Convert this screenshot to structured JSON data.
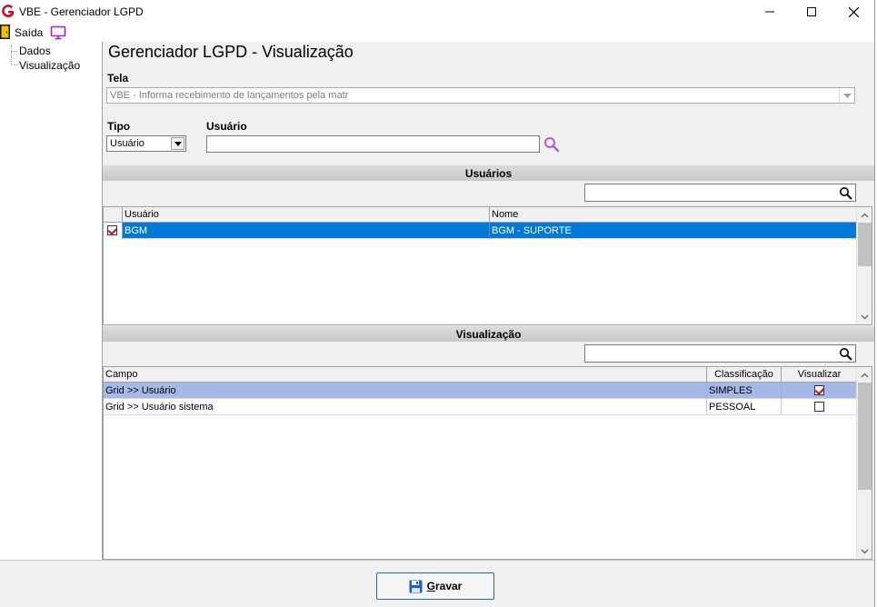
{
  "window": {
    "title": "VBE - Gerenciador LGPD",
    "minimize_icon": "minimize-icon",
    "maximize_icon": "maximize-icon",
    "close_icon": "close-icon"
  },
  "menu": {
    "exit_label": "Saída",
    "exit_icon": "exit-door-icon",
    "monitor_icon": "monitor-icon"
  },
  "tree": {
    "items": [
      "Dados",
      "Visualização"
    ]
  },
  "page": {
    "title": "Gerenciador LGPD - Visualização"
  },
  "form": {
    "tela_label": "Tela",
    "tela_value": "VBE - Informa recebimento de lançamentos pela matr",
    "tipo_label": "Tipo",
    "tipo_value": "Usuário",
    "usuario_label": "Usuário",
    "usuario_value": ""
  },
  "usuarios_section": {
    "title": "Usuários",
    "filter_value": "",
    "columns": [
      "Usuário",
      "Nome"
    ],
    "rows": [
      {
        "checked": true,
        "usuario": "BGM",
        "nome": "BGM - SUPORTE"
      }
    ]
  },
  "visualizacao_section": {
    "title": "Visualização",
    "filter_value": "",
    "columns": [
      "Campo",
      "Classificação",
      "Visualizar"
    ],
    "rows": [
      {
        "campo": "Grid >> Usuário",
        "classificacao": "SIMPLES",
        "visualizar": true
      },
      {
        "campo": "Grid >> Usuário sistema",
        "classificacao": "PESSOAL",
        "visualizar": false
      }
    ]
  },
  "footer": {
    "save_mnemonic": "G",
    "save_rest": "ravar",
    "save_icon": "floppy-disk-icon"
  },
  "colors": {
    "selected_row": "#0078d7",
    "selected_row_light": "#a6b9e6",
    "search_icon": "#9b59b6",
    "accent_red": "#c8102e"
  }
}
